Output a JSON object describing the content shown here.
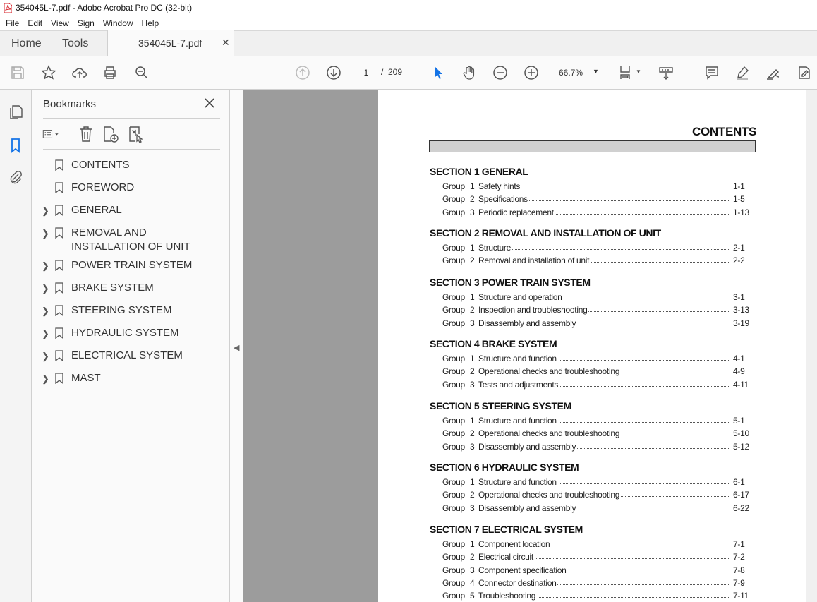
{
  "window": {
    "title": "354045L-7.pdf - Adobe Acrobat Pro DC (32-bit)"
  },
  "menu": [
    "File",
    "Edit",
    "View",
    "Sign",
    "Window",
    "Help"
  ],
  "tabs": {
    "home": "Home",
    "tools": "Tools",
    "document": "354045L-7.pdf"
  },
  "toolbar": {
    "page_current": "1",
    "page_separator": "/",
    "page_total": "209",
    "zoom": "66.7%"
  },
  "bookmarks": {
    "title": "Bookmarks",
    "items": [
      {
        "label": "CONTENTS",
        "expandable": false
      },
      {
        "label": "FOREWORD",
        "expandable": false
      },
      {
        "label": "GENERAL",
        "expandable": true
      },
      {
        "label": "REMOVAL AND INSTALLATION OF UNIT",
        "expandable": true
      },
      {
        "label": "POWER TRAIN SYSTEM",
        "expandable": true
      },
      {
        "label": "BRAKE SYSTEM",
        "expandable": true
      },
      {
        "label": "STEERING SYSTEM",
        "expandable": true
      },
      {
        "label": "HYDRAULIC SYSTEM",
        "expandable": true
      },
      {
        "label": "ELECTRICAL SYSTEM",
        "expandable": true
      },
      {
        "label": "MAST",
        "expandable": true
      }
    ]
  },
  "document": {
    "heading": "CONTENTS",
    "sections": [
      {
        "title": "SECTION 1  GENERAL",
        "groups": [
          {
            "word": "Group",
            "num": "1",
            "title": "Safety hints",
            "page": "1-1"
          },
          {
            "word": "Group",
            "num": "2",
            "title": "Specifications",
            "page": "1-5"
          },
          {
            "word": "Group",
            "num": "3",
            "title": "Periodic replacement",
            "page": "1-13"
          }
        ]
      },
      {
        "title": "SECTION 2  REMOVAL AND INSTALLATION OF UNIT",
        "groups": [
          {
            "word": "Group",
            "num": "1",
            "title": "Structure",
            "page": "2-1"
          },
          {
            "word": "Group",
            "num": "2",
            "title": "Removal and installation of unit",
            "page": "2-2"
          }
        ]
      },
      {
        "title": "SECTION 3  POWER TRAIN SYSTEM",
        "groups": [
          {
            "word": "Group",
            "num": "1",
            "title": "Structure and operation",
            "page": "3-1"
          },
          {
            "word": "Group",
            "num": "2",
            "title": "Inspection and troubleshooting",
            "page": "3-13"
          },
          {
            "word": "Group",
            "num": "3",
            "title": "Disassembly and assembly",
            "page": "3-19"
          }
        ]
      },
      {
        "title": "SECTION 4  BRAKE SYSTEM",
        "groups": [
          {
            "word": "Group",
            "num": "1",
            "title": "Structure and function",
            "page": "4-1"
          },
          {
            "word": "Group",
            "num": "2",
            "title": "Operational checks and troubleshooting",
            "page": "4-9"
          },
          {
            "word": "Group",
            "num": "3",
            "title": "Tests and adjustments",
            "page": "4-11"
          }
        ]
      },
      {
        "title": "SECTION 5  STEERING SYSTEM",
        "groups": [
          {
            "word": "Group",
            "num": "1",
            "title": "Structure and function",
            "page": "5-1"
          },
          {
            "word": "Group",
            "num": "2",
            "title": "Operational checks and troubleshooting",
            "page": "5-10"
          },
          {
            "word": "Group",
            "num": "3",
            "title": "Disassembly and assembly",
            "page": "5-12"
          }
        ]
      },
      {
        "title": "SECTION 6  HYDRAULIC SYSTEM",
        "groups": [
          {
            "word": "Group",
            "num": "1",
            "title": "Structure and function",
            "page": "6-1"
          },
          {
            "word": "Group",
            "num": "2",
            "title": "Operational checks and troubleshooting",
            "page": "6-17"
          },
          {
            "word": "Group",
            "num": "3",
            "title": "Disassembly and assembly",
            "page": "6-22"
          }
        ]
      },
      {
        "title": "SECTION 7  ELECTRICAL SYSTEM",
        "groups": [
          {
            "word": "Group",
            "num": "1",
            "title": "Component location",
            "page": "7-1"
          },
          {
            "word": "Group",
            "num": "2",
            "title": "Electrical circuit",
            "page": "7-2"
          },
          {
            "word": "Group",
            "num": "3",
            "title": "Component specification",
            "page": "7-8"
          },
          {
            "word": "Group",
            "num": "4",
            "title": "Connector destination",
            "page": "7-9"
          },
          {
            "word": "Group",
            "num": "5",
            "title": "Troubleshooting",
            "page": "7-11"
          }
        ]
      }
    ]
  },
  "colors": {
    "accent_blue": "#1473e6",
    "pdf_red": "#d7282f",
    "page_bg": "#9c9c9c"
  }
}
